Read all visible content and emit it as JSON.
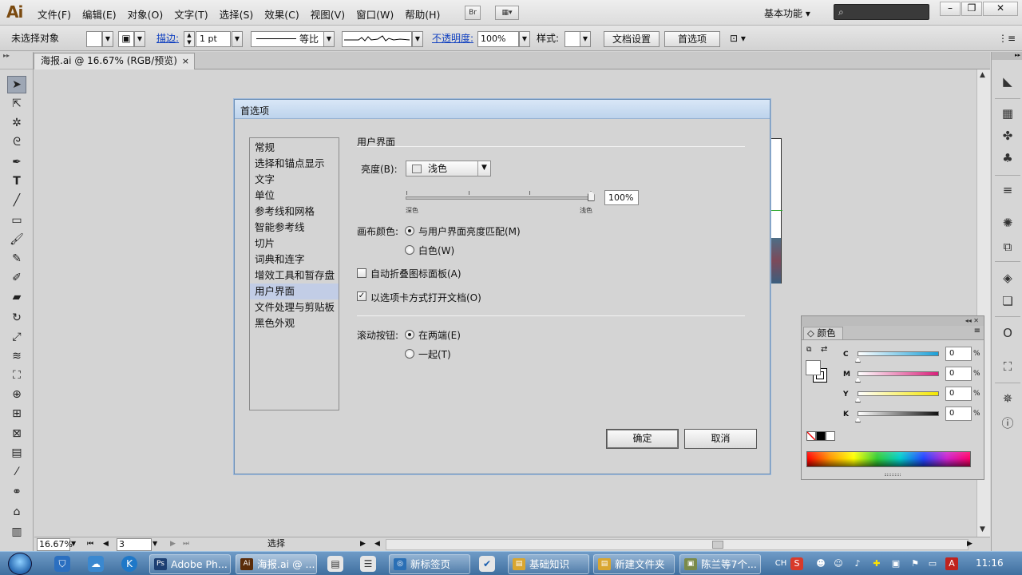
{
  "app": {
    "logo": "Ai",
    "menu": [
      "文件(F)",
      "编辑(E)",
      "对象(O)",
      "文字(T)",
      "选择(S)",
      "效果(C)",
      "视图(V)",
      "窗口(W)",
      "帮助(H)"
    ],
    "bridge_label": "Br",
    "workspace": "基本功能 ▾"
  },
  "control_bar": {
    "selection": "未选择对象",
    "stroke_label": "描边:",
    "stroke_weight": "1 pt",
    "stroke_profile": "等比",
    "opacity_label": "不透明度:",
    "opacity_value": "100%",
    "style_label": "样式:",
    "doc_setup_button": "文档设置",
    "prefs_button": "首选项"
  },
  "document_tab": {
    "title": "海报.ai @ 16.67% (RGB/预览)",
    "close": "×"
  },
  "status_bar": {
    "zoom": "16.67%",
    "artboard": "3",
    "tool": "选择"
  },
  "preferences": {
    "title": "首选项",
    "categories": [
      {
        "label": "常规",
        "selected": false
      },
      {
        "label": "选择和锚点显示",
        "selected": false
      },
      {
        "label": "文字",
        "selected": false
      },
      {
        "label": "单位",
        "selected": false
      },
      {
        "label": "参考线和网格",
        "selected": false
      },
      {
        "label": "智能参考线",
        "selected": false
      },
      {
        "label": "切片",
        "selected": false
      },
      {
        "label": "词典和连字",
        "selected": false
      },
      {
        "label": "增效工具和暂存盘",
        "selected": false
      },
      {
        "label": "用户界面",
        "selected": true
      },
      {
        "label": "文件处理与剪贴板",
        "selected": false
      },
      {
        "label": "黑色外观",
        "selected": false
      }
    ],
    "section_title": "用户界面",
    "brightness_label": "亮度(B):",
    "brightness_value": "浅色",
    "brightness_level_percent": 100,
    "brightness_text": "100%",
    "slider_min_label": "深色",
    "slider_max_label": "浅色",
    "canvas_color_label": "画布颜色:",
    "canvas_option_match": "与用户界面亮度匹配(M)",
    "canvas_option_white": "白色(W)",
    "canvas_selected": "match",
    "auto_collapse_label": "自动折叠图标面板(A)",
    "auto_collapse_checked": false,
    "open_tabs_label": "以选项卡方式打开文档(O)",
    "open_tabs_checked": true,
    "scroll_buttons_label": "滚动按钮:",
    "scroll_option_ends": "在两端(E)",
    "scroll_option_together": "一起(T)",
    "scroll_selected": "ends",
    "ok_button": "确定",
    "cancel_button": "取消"
  },
  "color_panel": {
    "title": "颜色",
    "channels": [
      {
        "label": "C",
        "value": "0",
        "unit": "%",
        "color_from": "#ffffff",
        "color_to": "#1aa0d8"
      },
      {
        "label": "M",
        "value": "0",
        "unit": "%",
        "color_from": "#ffffff",
        "color_to": "#d8207a"
      },
      {
        "label": "Y",
        "value": "0",
        "unit": "%",
        "color_from": "#ffffff",
        "color_to": "#f4e600"
      },
      {
        "label": "K",
        "value": "0",
        "unit": "%",
        "color_from": "#ffffff",
        "color_to": "#111111"
      }
    ]
  },
  "taskbar": {
    "tasks": [
      {
        "label": "Adobe Ph...",
        "icon": "Ps",
        "color": "#1c3f73"
      },
      {
        "label": "海报.ai @ ...",
        "icon": "Ai",
        "color": "#5a2c0a",
        "active": true
      },
      {
        "label": "新标签页",
        "icon": "◎",
        "color": "#2a6fb5"
      },
      {
        "label": "基础知识",
        "icon": "▤",
        "color": "#d9a630"
      },
      {
        "label": "新建文件夹",
        "icon": "▤",
        "color": "#d9a630"
      },
      {
        "label": "陈兰等7个...",
        "icon": "▣",
        "color": "#7a8a4a"
      }
    ],
    "ime": "CH",
    "clock": "11:16"
  }
}
